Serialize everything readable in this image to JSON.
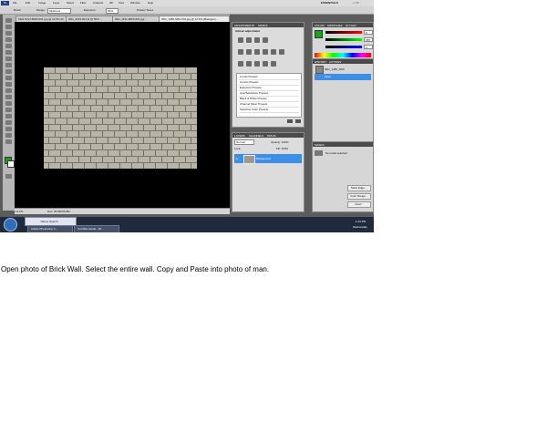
{
  "menubar": {
    "app_badge": "Ps",
    "items": [
      "File",
      "Edit",
      "Image",
      "Layer",
      "Select",
      "Filter",
      "Analysis",
      "3D",
      "View",
      "Window",
      "Help"
    ],
    "workspace": "ESSENTIALS"
  },
  "options_bar": {
    "tool_label": "Brush",
    "mode_label": "Range:",
    "mode_value": "Midtones",
    "exposure_label": "Exposure:",
    "exposure_value": "50%",
    "protect_tones": "Protect Tones"
  },
  "document_tabs": [
    "KEN-SON-BRW-001.jpg @ 12.5% (R...",
    "IMG_4323-001.tif @ 50% ...",
    "IMG_1191-MRS-001.jpg...",
    "IMG_1480-SRS-001.jpg @ 12.5% (Backgrou..."
  ],
  "status_bar": {
    "zoom": "12.5%",
    "doc": "Doc: 36.8M/36.8M"
  },
  "adjustments_panel": {
    "tabs": [
      "ADJUSTMENTS",
      "MASKS"
    ],
    "header": "Add an adjustment",
    "presets": [
      "Levels Presets",
      "Curves Presets",
      "Exposure Presets",
      "Hue/Saturation Presets",
      "Black & White Presets",
      "Channel Mixer Presets",
      "Selective Color Presets"
    ]
  },
  "layers_panel": {
    "tabs": [
      "LAYERS",
      "CHANNELS",
      "PATHS"
    ],
    "blend_mode": "Normal",
    "opacity": "Opacity: 100%",
    "lock": "Lock:",
    "fill": "Fill: 100%",
    "layer_name": "Background"
  },
  "color_panel": {
    "tabs": [
      "COLOR",
      "SWATCHES",
      "STYLES"
    ],
    "r_value": "0",
    "g_value": "255",
    "b_value": "0",
    "accent": "#1aa31a"
  },
  "history_panel": {
    "tabs": [
      "HISTORY",
      "ACTIONS"
    ],
    "snapshot": "IMG_1480_SRS",
    "step": "Open"
  },
  "masks_panel": {
    "tabs": [
      "MASKS"
    ],
    "header": "No mask selected",
    "buttons": [
      "Mask Edge...",
      "Color Range...",
      "Invert"
    ]
  },
  "taskbar": {
    "search_label": "Yahoo! Search",
    "tasks": [
      "Adobe Photoshop C...",
      "Cut Man Guide - Mi..."
    ],
    "clock": "1:23 PM",
    "day": "Wednesday"
  },
  "caption": "Open photo of Brick Wall. Select the entire wall. Copy and Paste into photo of man."
}
